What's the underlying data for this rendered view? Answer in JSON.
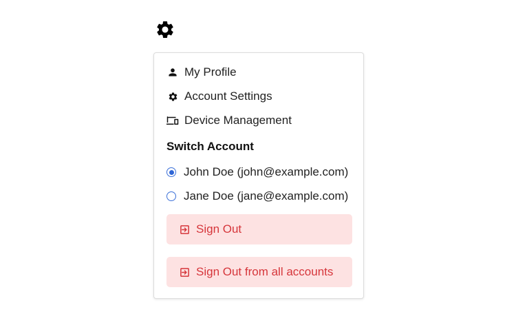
{
  "trigger": {
    "icon": "gear-icon"
  },
  "menu": {
    "items": [
      {
        "label": "My Profile",
        "icon": "person-icon"
      },
      {
        "label": "Account Settings",
        "icon": "gear-icon"
      },
      {
        "label": "Device Management",
        "icon": "devices-icon"
      }
    ],
    "switch_account": {
      "title": "Switch Account",
      "accounts": [
        {
          "label": "John Doe (john@example.com)",
          "selected": true
        },
        {
          "label": "Jane Doe (jane@example.com)",
          "selected": false
        }
      ]
    },
    "sign_out": {
      "label": "Sign Out",
      "icon": "sign-out-icon"
    },
    "sign_out_all": {
      "label": "Sign Out from all accounts",
      "icon": "sign-out-icon"
    }
  },
  "colors": {
    "accent_radio": "#2f66d6",
    "danger_text": "#d6363b",
    "danger_bg": "#fde2e2"
  }
}
